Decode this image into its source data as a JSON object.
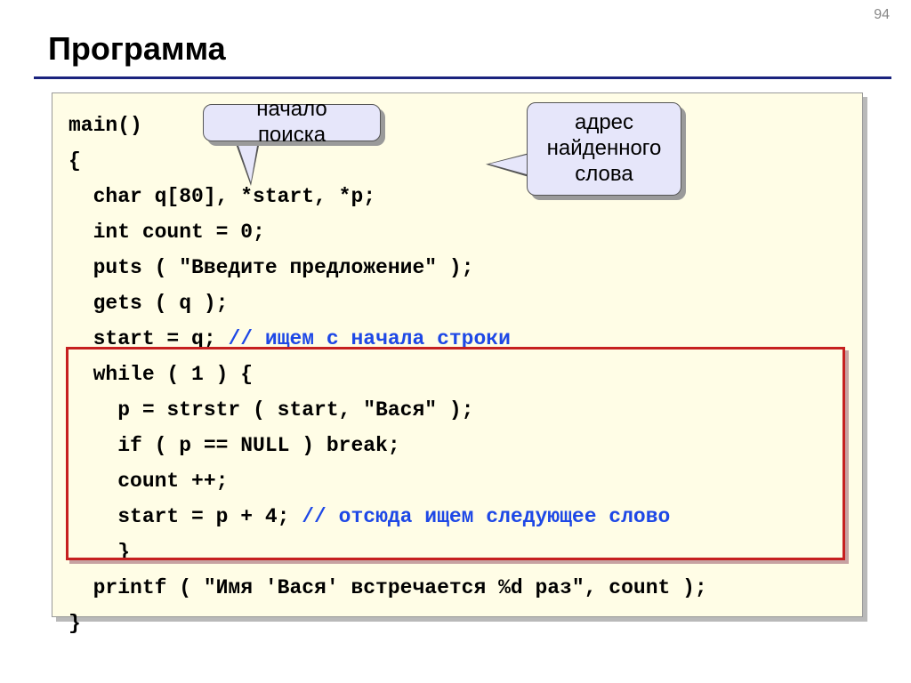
{
  "page_number": "94",
  "title": "Программа",
  "callouts": {
    "c1": "начало поиска",
    "c2_line1": "адрес",
    "c2_line2": "найденного",
    "c2_line3": "слова"
  },
  "code": {
    "l01": "main()",
    "l02": "{",
    "l03": "  char q[80], *start, *p;",
    "l04": "  int count = 0;",
    "l05": "  puts ( \"Введите предложение\" );",
    "l06": "  gets ( q );",
    "l07a": "  start = q; ",
    "l07c": "// ищем с начала строки",
    "l08": "  while ( 1 ) {",
    "l09": "    p = strstr ( start, \"Вася\" );",
    "l10": "    if ( p == NULL ) break;",
    "l11": "    count ++;",
    "l12a": "    start = p + 4; ",
    "l12c": "// отсюда ищем следующее слово",
    "l13": "    }",
    "l14": "  printf ( \"Имя 'Вася' встречается %d раз\", count );",
    "l15": "}"
  }
}
